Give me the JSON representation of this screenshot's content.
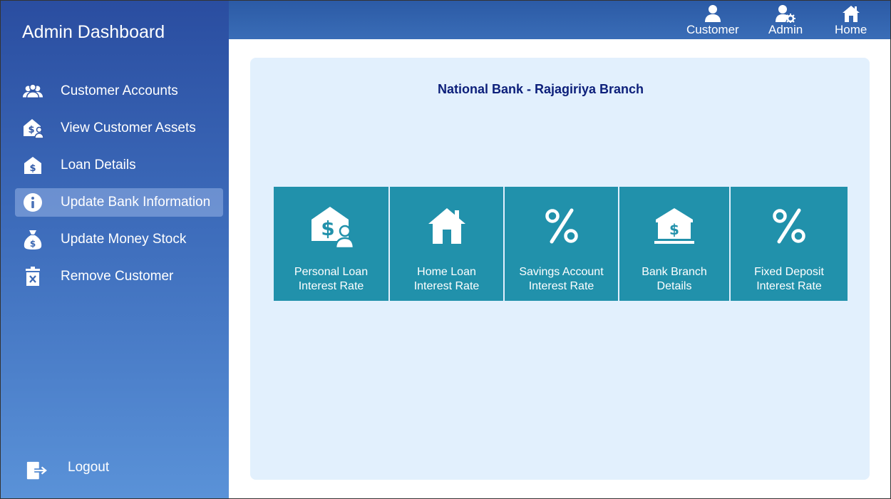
{
  "sidebar": {
    "title": "Admin Dashboard",
    "items": [
      {
        "label": "Customer Accounts",
        "icon": "users-icon",
        "active": false
      },
      {
        "label": "View Customer Assets",
        "icon": "customer-assets-icon",
        "active": false
      },
      {
        "label": "Loan Details",
        "icon": "loan-icon",
        "active": false
      },
      {
        "label": "Update Bank  Information",
        "icon": "info-icon",
        "active": true
      },
      {
        "label": "Update Money Stock",
        "icon": "money-bag-icon",
        "active": false
      },
      {
        "label": "Remove Customer",
        "icon": "delete-icon",
        "active": false
      }
    ],
    "logout_label": "Logout"
  },
  "header": {
    "buttons": [
      {
        "label": "Customer",
        "icon": "user-icon"
      },
      {
        "label": "Admin",
        "icon": "admin-icon"
      },
      {
        "label": "Home",
        "icon": "home-icon"
      }
    ]
  },
  "main": {
    "title": "National Bank - Rajagiriya Branch",
    "tiles": [
      {
        "label": "Personal  Loan\nInterest  Rate",
        "icon": "personal-loan-icon"
      },
      {
        "label": "Home Loan\nInterest Rate",
        "icon": "house-icon"
      },
      {
        "label": "Savings Account\nInterest Rate",
        "icon": "percent-icon"
      },
      {
        "label": "Bank Branch\nDetails",
        "icon": "bank-icon"
      },
      {
        "label": "Fixed  Deposit\nInterest Rate",
        "icon": "percent-icon"
      }
    ]
  },
  "colors": {
    "sidebar_top": "#2a4da0",
    "sidebar_bottom": "#5a92d8",
    "panel_bg": "#e2f0fd",
    "tile_bg": "#2191ab",
    "title_text": "#0c1f7a"
  }
}
